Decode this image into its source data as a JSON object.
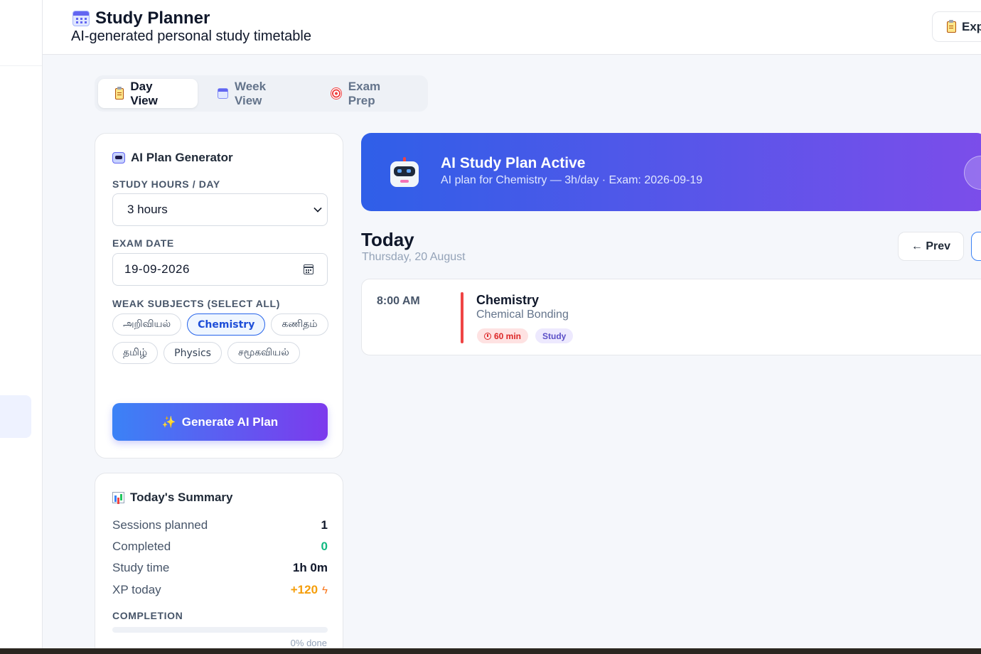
{
  "header": {
    "title": "Study Planner",
    "subtitle": "AI-generated personal study timetable",
    "export_label": "Exp"
  },
  "tabs": [
    {
      "label": "Day View",
      "active": true
    },
    {
      "label": "Week View",
      "active": false
    },
    {
      "label": "Exam Prep",
      "active": false
    }
  ],
  "generator": {
    "title": "AI Plan Generator",
    "hours_label": "STUDY HOURS / DAY",
    "hours_value": "3 hours",
    "exam_date_label": "EXAM DATE",
    "exam_date_value": "19-09-2026",
    "weak_label": "WEAK SUBJECTS (SELECT ALL)",
    "subjects": [
      {
        "name": "அறிவியல்",
        "selected": false
      },
      {
        "name": "Chemistry",
        "selected": true
      },
      {
        "name": "கணிதம்",
        "selected": false
      },
      {
        "name": "தமிழ்",
        "selected": false
      },
      {
        "name": "Physics",
        "selected": false
      },
      {
        "name": "சமூகவியல்",
        "selected": false
      }
    ],
    "button_label": "Generate AI Plan"
  },
  "summary": {
    "title": "Today's Summary",
    "rows": {
      "sessions": {
        "label": "Sessions planned",
        "value": "1"
      },
      "completed": {
        "label": "Completed",
        "value": "0"
      },
      "study_time": {
        "label": "Study time",
        "value": "1h 0m"
      },
      "xp": {
        "label": "XP today",
        "value": "+120"
      }
    },
    "completion_label": "COMPLETION",
    "completion_fraction": 0,
    "completion_text": "0% done"
  },
  "banner": {
    "title": "AI Study Plan Active",
    "subtitle": "AI plan for Chemistry — 3h/day · Exam: 2026-09-19"
  },
  "day": {
    "title": "Today",
    "date": "Thursday, 20 August",
    "prev_label": "← Prev"
  },
  "sessions": [
    {
      "time": "8:00 AM",
      "subject": "Chemistry",
      "topic": "Chemical Bonding",
      "duration": "60 min",
      "type": "Study"
    }
  ],
  "colors": {
    "accent": "#2563eb",
    "gradient_start": "#3b82f6",
    "gradient_end": "#7c3aed",
    "session_bar": "#ef4444",
    "success": "#10b981",
    "xp": "#f59e0b"
  }
}
